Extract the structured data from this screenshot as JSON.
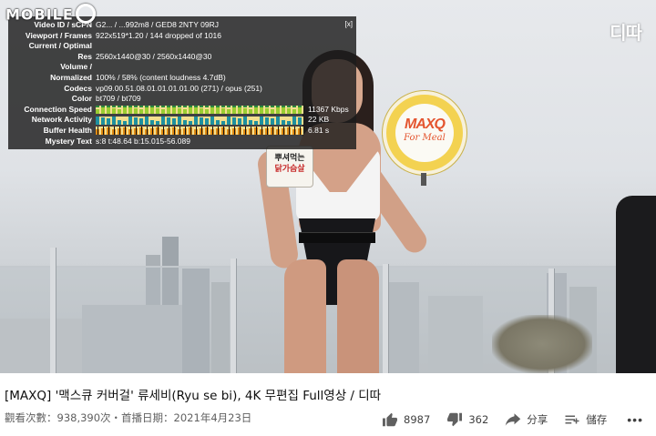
{
  "site_logo": {
    "text": "MOBILE"
  },
  "channel_logo": {
    "text": "디따"
  },
  "video_overlay": {
    "sign_card": {
      "line1": "뿌셔먹는",
      "line2": "닭가슴살"
    },
    "fan": {
      "brand": "MAXQ",
      "sub": "For Meal",
      "ring_top": "THE HEALTHY FOOD SERVICE",
      "ring_bottom": "THE SUPERFOOD FOR YOU"
    }
  },
  "stats": {
    "close_label": "[x]",
    "rows": [
      {
        "key": "Video ID / sCPN",
        "val": "G2... / ...992m8 / GED8 2NTY 09RJ"
      },
      {
        "key": "Viewport / Frames",
        "val": "922x519*1.20 / 144 dropped of 1016"
      },
      {
        "key": "Current / Optimal",
        "val": ""
      },
      {
        "key": "Res",
        "val": "2560x1440@30 / 2560x1440@30"
      },
      {
        "key": "Volume /",
        "val": ""
      },
      {
        "key": "Normalized",
        "val": "100% / 58% (content loudness 4.7dB)"
      },
      {
        "key": "Codecs",
        "val": "vp09.00.51.08.01.01.01.01.00 (271) / opus (251)"
      },
      {
        "key": "Color",
        "val": "bt709 / bt709"
      }
    ],
    "graph_rows": [
      {
        "key": "Connection Speed",
        "val": "11367 Kbps",
        "color": "#9acd32"
      },
      {
        "key": "Network Activity",
        "val": "22 KB",
        "color": "#1e90a0"
      },
      {
        "key": "Buffer Health",
        "val": "6.81 s",
        "color": "#e08a12"
      }
    ],
    "mystery": {
      "key": "Mystery Text",
      "val": "s:8 t:48.64 b:15.015-56.089"
    }
  },
  "video": {
    "title": "[MAXQ] '맥스큐 커버걸' 류세비(Ryu se bi), 4K 무편집 Full영상 / 디따",
    "meta": "觀看次數：938,390次・首播日期：2021年4月23日"
  },
  "actions": {
    "like_count": "8987",
    "dislike_count": "362",
    "share_label": "分享",
    "save_label": "儲存",
    "more_label": "•••"
  },
  "colors": {
    "graph_bg": "#f3df8f",
    "panel_bg": "#1c1c1c"
  }
}
